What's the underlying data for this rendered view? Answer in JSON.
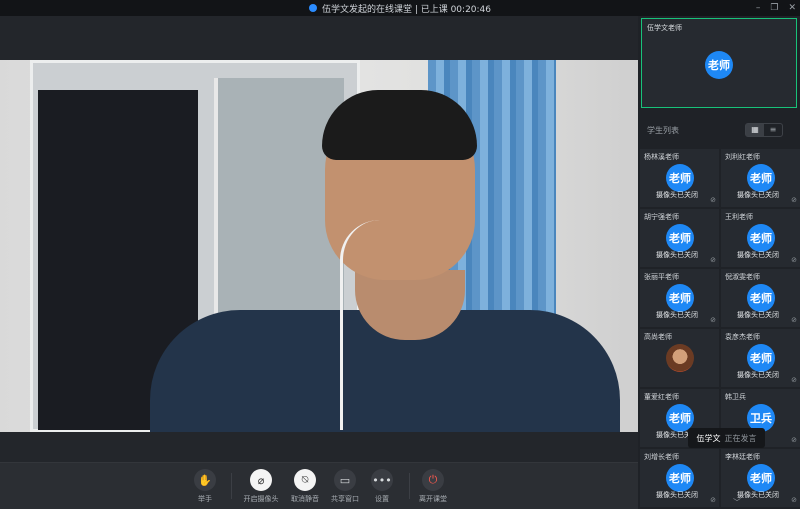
{
  "window": {
    "title": "伍学文发起的在线课堂 | 已上课 00:20:46",
    "controls": [
      "–",
      "❐",
      "✕"
    ]
  },
  "toolbar": {
    "buttons": [
      {
        "label": "举手",
        "icon": "hand-icon",
        "glyph": "✋"
      },
      {
        "label": "开启摄像头",
        "icon": "camera-off-icon",
        "glyph": "⌀"
      },
      {
        "label": "取消静音",
        "icon": "mic-off-icon",
        "glyph": "⍉"
      },
      {
        "label": "共享窗口",
        "icon": "share-screen-icon",
        "glyph": "▭"
      },
      {
        "label": "设置",
        "icon": "more-icon",
        "glyph": "•••"
      },
      {
        "label": "离开课堂",
        "icon": "power-icon",
        "glyph": "⏻"
      }
    ]
  },
  "teacher": {
    "name": "伍学文老师",
    "avatar_text": "老师"
  },
  "student_list": {
    "title": "学生列表",
    "view_grid": "▦",
    "view_list": "≡",
    "camera_off_text": "摄像头已关闭",
    "mic_glyph": "⊘",
    "students": [
      {
        "name": "杨林溪老师",
        "avatar": "老师"
      },
      {
        "name": "刘利红老师",
        "avatar": "老师"
      },
      {
        "name": "胡宁强老师",
        "avatar": "老师"
      },
      {
        "name": "王利老师",
        "avatar": "老师"
      },
      {
        "name": "张丽平老师",
        "avatar": "老师"
      },
      {
        "name": "倪淑雯老师",
        "avatar": "老师"
      },
      {
        "name": "高尚老师",
        "avatar": ""
      },
      {
        "name": "袁彦杰老师",
        "avatar": "老师"
      },
      {
        "name": "董爱红老师",
        "avatar": "老师"
      },
      {
        "name": "韩卫兵",
        "avatar": "卫兵"
      },
      {
        "name": "刘增长老师",
        "avatar": "老师"
      },
      {
        "name": "李林廷老师",
        "avatar": "老师"
      }
    ]
  },
  "speaking_tooltip": {
    "name": "伍学文",
    "status": "正在发言"
  },
  "scroll_indicator": "﹀",
  "colors": {
    "avatar_blue": "#1e88f5",
    "active_green": "#18c27a",
    "leave_red": "#ff5a4e"
  }
}
